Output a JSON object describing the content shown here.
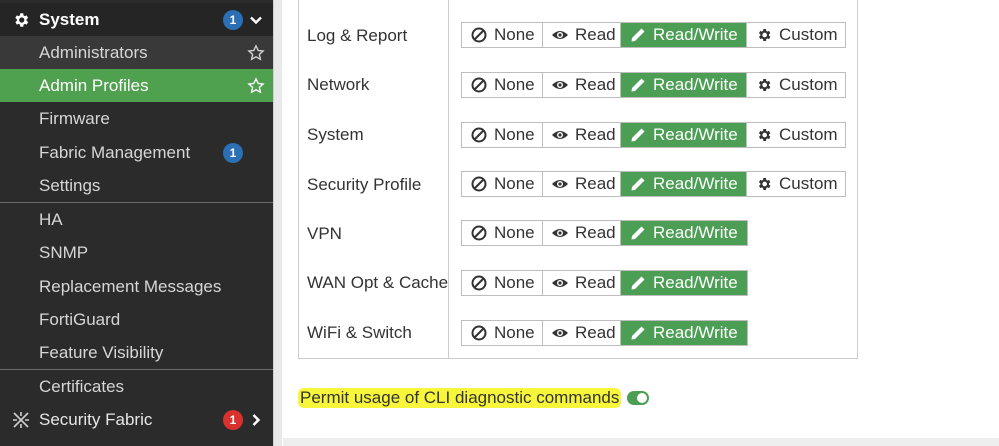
{
  "sidebar": {
    "header": {
      "label": "System",
      "badge": "1",
      "icon": "gear-icon",
      "trail_icon": "chevron-down-icon"
    },
    "items": [
      {
        "label": "Administrators",
        "trail_icon": "star-icon"
      },
      {
        "label": "Admin Profiles",
        "trail_icon": "star-icon",
        "active": true
      },
      {
        "label": "Firmware"
      },
      {
        "label": "Fabric Management",
        "badge": "1"
      },
      {
        "label": "Settings"
      },
      {
        "label": "HA"
      },
      {
        "label": "SNMP"
      },
      {
        "label": "Replacement Messages"
      },
      {
        "label": "FortiGuard"
      },
      {
        "label": "Feature Visibility"
      },
      {
        "label": "Certificates"
      }
    ],
    "footer": {
      "label": "Security Fabric",
      "badge": "1",
      "icon": "security-fabric-icon",
      "trail_icon": "chevron-right-icon"
    }
  },
  "permissions": {
    "options": {
      "none": "None",
      "read": "Read",
      "read_write": "Read/Write",
      "custom": "Custom"
    },
    "rows": [
      {
        "label": "Log & Report",
        "selected": "Read/Write",
        "has_custom": true
      },
      {
        "label": "Network",
        "selected": "Read/Write",
        "has_custom": true
      },
      {
        "label": "System",
        "selected": "Read/Write",
        "has_custom": true
      },
      {
        "label": "Security Profile",
        "selected": "Read/Write",
        "has_custom": true
      },
      {
        "label": "VPN",
        "selected": "Read/Write",
        "has_custom": false
      },
      {
        "label": "WAN Opt & Cache",
        "selected": "Read/Write",
        "has_custom": false
      },
      {
        "label": "WiFi & Switch",
        "selected": "Read/Write",
        "has_custom": false
      }
    ]
  },
  "cli": {
    "label": "Permit usage of CLI diagnostic commands",
    "enabled": true
  },
  "colors": {
    "accent": "#4b9e54",
    "sidebar_bg": "#2b2b2b",
    "badge_blue": "#2b6fb5",
    "badge_red": "#d9322e",
    "highlight": "#f7f63a"
  }
}
